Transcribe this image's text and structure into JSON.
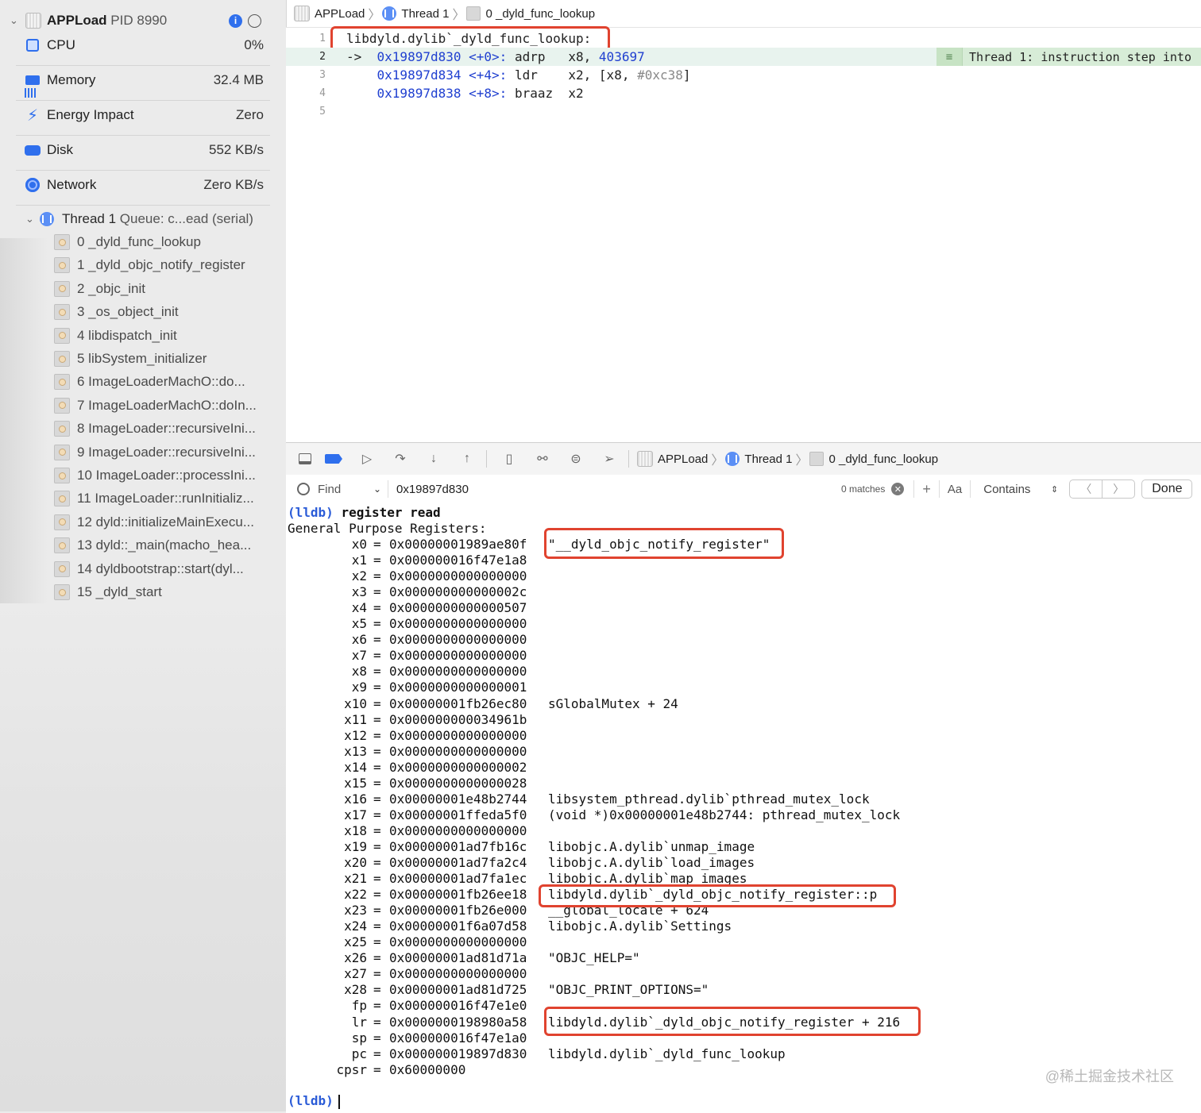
{
  "sidebar": {
    "app_name": "APPLoad",
    "pid": "PID 8990",
    "gauges": [
      {
        "label": "CPU",
        "value": "0%",
        "icon": "cpu-icon"
      },
      {
        "label": "Memory",
        "value": "32.4 MB",
        "icon": "memory-icon"
      },
      {
        "label": "Energy Impact",
        "value": "Zero",
        "icon": "bolt-icon"
      },
      {
        "label": "Disk",
        "value": "552 KB/s",
        "icon": "disk-icon"
      },
      {
        "label": "Network",
        "value": "Zero KB/s",
        "icon": "globe-icon"
      }
    ],
    "thread": {
      "label": "Thread 1",
      "queue": "Queue: c...ead (serial)"
    },
    "frames": [
      "0 _dyld_func_lookup",
      "1 _dyld_objc_notify_register",
      "2 _objc_init",
      "3 _os_object_init",
      "4 libdispatch_init",
      "5 libSystem_initializer",
      "6 ImageLoaderMachO::do...",
      "7 ImageLoaderMachO::doIn...",
      "8 ImageLoader::recursiveIni...",
      "9 ImageLoader::recursiveIni...",
      "10 ImageLoader::processIni...",
      "11 ImageLoader::runInitializ...",
      "12 dyld::initializeMainExecu...",
      "13 dyld::_main(macho_hea...",
      "14 dyldbootstrap::start(dyl...",
      "15 _dyld_start"
    ]
  },
  "breadcrumb": {
    "app": "APPLoad",
    "thread": "Thread 1",
    "frame": "0 _dyld_func_lookup"
  },
  "editor": {
    "lines": [
      {
        "n": "1",
        "text": "libdyld.dylib`_dyld_func_lookup:"
      },
      {
        "n": "2",
        "arrow": "->",
        "addr": "0x19897d830",
        "off": "<+0>:",
        "op": "adrp",
        "args": "x8, ",
        "num": "403697"
      },
      {
        "n": "3",
        "addr": "0x19897d834",
        "off": "<+4>:",
        "op": "ldr",
        "args": "x2, [x8, ",
        "hash": "#0xc38",
        "tail": "]"
      },
      {
        "n": "4",
        "addr": "0x19897d838",
        "off": "<+8>:",
        "op": "braaz",
        "args": "x2"
      },
      {
        "n": "5"
      }
    ],
    "step_badge": "Thread 1: instruction step into"
  },
  "debug_bar": {
    "app": "APPLoad",
    "thread": "Thread 1",
    "frame": "0 _dyld_func_lookup"
  },
  "find": {
    "mode": "Find",
    "query": "0x19897d830",
    "matches": "0 matches",
    "case": "Aa",
    "match_type": "Contains",
    "done": "Done"
  },
  "console": {
    "prompt": "(lldb)",
    "command": "register read",
    "header": "General Purpose Registers:",
    "registers": [
      {
        "name": "x0",
        "value": "0x00000001989ae80f",
        "desc": "\"__dyld_objc_notify_register\""
      },
      {
        "name": "x1",
        "value": "0x000000016f47e1a8",
        "desc": ""
      },
      {
        "name": "x2",
        "value": "0x0000000000000000",
        "desc": ""
      },
      {
        "name": "x3",
        "value": "0x000000000000002c",
        "desc": ""
      },
      {
        "name": "x4",
        "value": "0x0000000000000507",
        "desc": ""
      },
      {
        "name": "x5",
        "value": "0x0000000000000000",
        "desc": ""
      },
      {
        "name": "x6",
        "value": "0x0000000000000000",
        "desc": ""
      },
      {
        "name": "x7",
        "value": "0x0000000000000000",
        "desc": ""
      },
      {
        "name": "x8",
        "value": "0x0000000000000000",
        "desc": ""
      },
      {
        "name": "x9",
        "value": "0x0000000000000001",
        "desc": ""
      },
      {
        "name": "x10",
        "value": "0x00000001fb26ec80",
        "desc": "sGlobalMutex + 24"
      },
      {
        "name": "x11",
        "value": "0x000000000034961b",
        "desc": ""
      },
      {
        "name": "x12",
        "value": "0x0000000000000000",
        "desc": ""
      },
      {
        "name": "x13",
        "value": "0x0000000000000000",
        "desc": ""
      },
      {
        "name": "x14",
        "value": "0x0000000000000002",
        "desc": ""
      },
      {
        "name": "x15",
        "value": "0x0000000000000028",
        "desc": ""
      },
      {
        "name": "x16",
        "value": "0x00000001e48b2744",
        "desc": "libsystem_pthread.dylib`pthread_mutex_lock"
      },
      {
        "name": "x17",
        "value": "0x00000001ffeda5f0",
        "desc": "(void *)0x00000001e48b2744: pthread_mutex_lock"
      },
      {
        "name": "x18",
        "value": "0x0000000000000000",
        "desc": ""
      },
      {
        "name": "x19",
        "value": "0x00000001ad7fb16c",
        "desc": "libobjc.A.dylib`unmap_image"
      },
      {
        "name": "x20",
        "value": "0x00000001ad7fa2c4",
        "desc": "libobjc.A.dylib`load_images"
      },
      {
        "name": "x21",
        "value": "0x00000001ad7fa1ec",
        "desc": "libobjc.A.dylib`map_images"
      },
      {
        "name": "x22",
        "value": "0x00000001fb26ee18",
        "desc": "libdyld.dylib`_dyld_objc_notify_register::p"
      },
      {
        "name": "x23",
        "value": "0x00000001fb26e000",
        "desc": "__global_locale + 624"
      },
      {
        "name": "x24",
        "value": "0x00000001f6a07d58",
        "desc": "libobjc.A.dylib`Settings"
      },
      {
        "name": "x25",
        "value": "0x0000000000000000",
        "desc": ""
      },
      {
        "name": "x26",
        "value": "0x00000001ad81d71a",
        "desc": "\"OBJC_HELP=\""
      },
      {
        "name": "x27",
        "value": "0x0000000000000000",
        "desc": ""
      },
      {
        "name": "x28",
        "value": "0x00000001ad81d725",
        "desc": "\"OBJC_PRINT_OPTIONS=\""
      },
      {
        "name": "fp",
        "value": "0x000000016f47e1e0",
        "desc": ""
      },
      {
        "name": "lr",
        "value": "0x0000000198980a58",
        "desc": "libdyld.dylib`_dyld_objc_notify_register + 216"
      },
      {
        "name": "sp",
        "value": "0x000000016f47e1a0",
        "desc": ""
      },
      {
        "name": "pc",
        "value": "0x000000019897d830",
        "desc": "libdyld.dylib`_dyld_func_lookup"
      },
      {
        "name": "cpsr",
        "value": "0x60000000",
        "desc": ""
      }
    ]
  },
  "watermark": "@稀土掘金技术社区"
}
